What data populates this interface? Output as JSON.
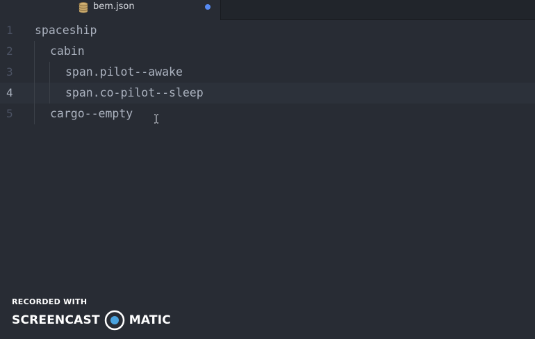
{
  "tab": {
    "icon": "database-icon",
    "filename": "bem.json",
    "modified": true,
    "modified_color": "#568af2"
  },
  "editor": {
    "background": "#282c34",
    "text_color": "#abb2bf",
    "lines": [
      {
        "number": "1",
        "text": "spaceship",
        "indent": 0
      },
      {
        "number": "2",
        "text": "cabin",
        "indent": 1
      },
      {
        "number": "3",
        "text": "span.pilot--awake",
        "indent": 2
      },
      {
        "number": "4",
        "text": "span.co-pilot--sleep",
        "indent": 2,
        "active": true
      },
      {
        "number": "5",
        "text": "cargo--empty",
        "indent": 1
      }
    ]
  },
  "watermark": {
    "top": "RECORDED WITH",
    "left_word": "SCREENCAST",
    "right_word": "MATIC"
  }
}
